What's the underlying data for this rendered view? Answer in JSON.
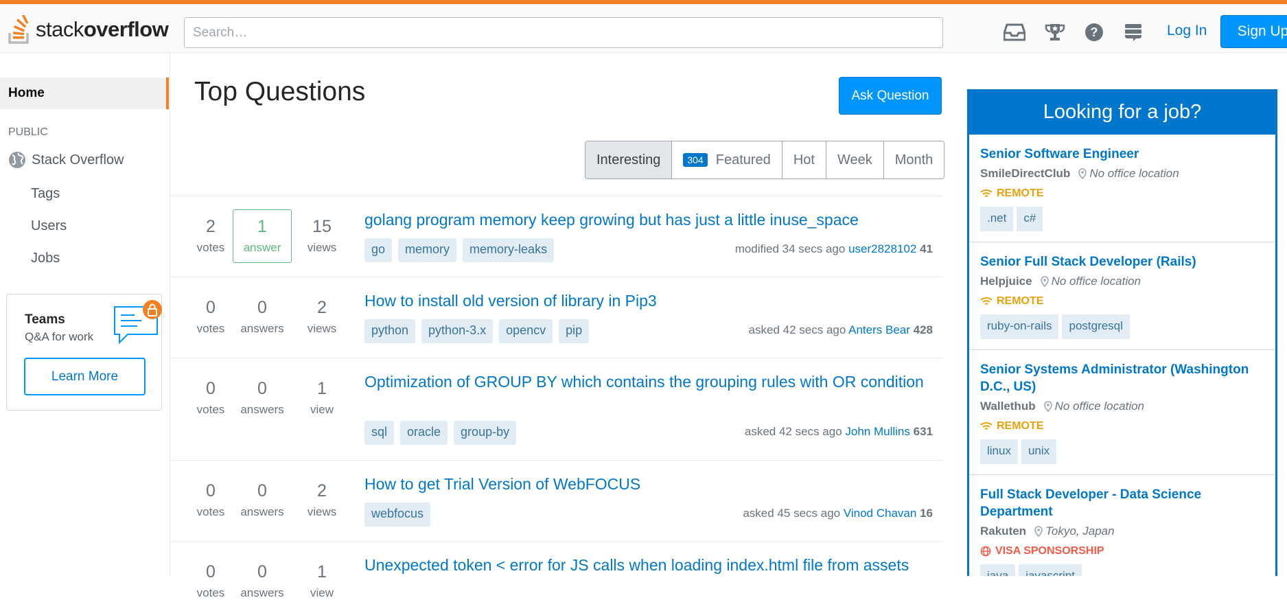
{
  "header": {
    "logo_prefix": "stack",
    "logo_suffix": "overflow",
    "search_placeholder": "Search…",
    "icons": [
      "inbox-icon",
      "trophy-icon",
      "help-icon",
      "stackexchange-icon"
    ],
    "login_label": "Log In",
    "signup_label": "Sign Up"
  },
  "sidebar": {
    "home": "Home",
    "public_label": "PUBLIC",
    "stack_overflow": "Stack Overflow",
    "items": [
      "Tags",
      "Users",
      "Jobs"
    ],
    "teams": {
      "title": "Teams",
      "subtitle": "Q&A for work",
      "button": "Learn More"
    }
  },
  "main": {
    "title": "Top Questions",
    "ask_button": "Ask Question",
    "filters": [
      {
        "label": "Interesting",
        "active": true
      },
      {
        "label": "Featured",
        "badge": "304"
      },
      {
        "label": "Hot"
      },
      {
        "label": "Week"
      },
      {
        "label": "Month"
      }
    ],
    "questions": [
      {
        "votes": "2",
        "votes_label": "votes",
        "answers": "1",
        "answers_label": "answer",
        "answered": true,
        "views": "15",
        "views_label": "views",
        "title": "golang program memory keep growing but has just a little inuse_space",
        "tags": [
          "go",
          "memory",
          "memory-leaks"
        ],
        "action": "modified 34 secs ago",
        "user": "user2828102",
        "rep": "41"
      },
      {
        "votes": "0",
        "votes_label": "votes",
        "answers": "0",
        "answers_label": "answers",
        "views": "2",
        "views_label": "views",
        "title": "How to install old version of library in Pip3",
        "tags": [
          "python",
          "python-3.x",
          "opencv",
          "pip"
        ],
        "action": "asked 42 secs ago",
        "user": "Anters Bear",
        "rep": "428"
      },
      {
        "votes": "0",
        "votes_label": "votes",
        "answers": "0",
        "answers_label": "answers",
        "views": "1",
        "views_label": "view",
        "title": "Optimization of GROUP BY which contains the grouping rules with OR condition",
        "tags": [
          "sql",
          "oracle",
          "group-by"
        ],
        "action": "asked 42 secs ago",
        "user": "John Mullins",
        "rep": "631"
      },
      {
        "votes": "0",
        "votes_label": "votes",
        "answers": "0",
        "answers_label": "answers",
        "views": "2",
        "views_label": "views",
        "title": "How to get Trial Version of WebFOCUS",
        "tags": [
          "webfocus"
        ],
        "action": "asked 45 secs ago",
        "user": "Vinod Chavan",
        "rep": "16"
      },
      {
        "votes": "0",
        "votes_label": "votes",
        "answers": "0",
        "answers_label": "answers",
        "views": "1",
        "views_label": "view",
        "title": "Unexpected token < error for JS calls when loading index.html file from assets",
        "tags": [],
        "action": "",
        "user": "",
        "rep": ""
      }
    ]
  },
  "jobs": {
    "heading": "Looking for a job?",
    "listings": [
      {
        "title": "Senior Software Engineer",
        "company": "SmileDirectClub",
        "location": "No office location",
        "perk": "REMOTE",
        "perk_type": "remote",
        "tags": [
          ".net",
          "c#"
        ]
      },
      {
        "title": "Senior Full Stack Developer (Rails)",
        "company": "Helpjuice",
        "location": "No office location",
        "perk": "REMOTE",
        "perk_type": "remote",
        "tags": [
          "ruby-on-rails",
          "postgresql"
        ]
      },
      {
        "title": "Senior Systems Administrator (Washington D.C., US)",
        "company": "Wallethub",
        "location": "No office location",
        "perk": "REMOTE",
        "perk_type": "remote",
        "tags": [
          "linux",
          "unix"
        ]
      },
      {
        "title": "Full Stack Developer - Data Science Department",
        "company": "Rakuten",
        "location": "Tokyo, Japan",
        "perk": "VISA SPONSORSHIP",
        "perk_type": "visa",
        "tags": [
          "java",
          "javascript"
        ]
      }
    ]
  },
  "colors": {
    "accent": "#f48024",
    "link": "#0077cc",
    "button": "#0095ff",
    "answered": "#5eba7d",
    "remote": "#e8a10b",
    "visa": "#f55a47"
  }
}
